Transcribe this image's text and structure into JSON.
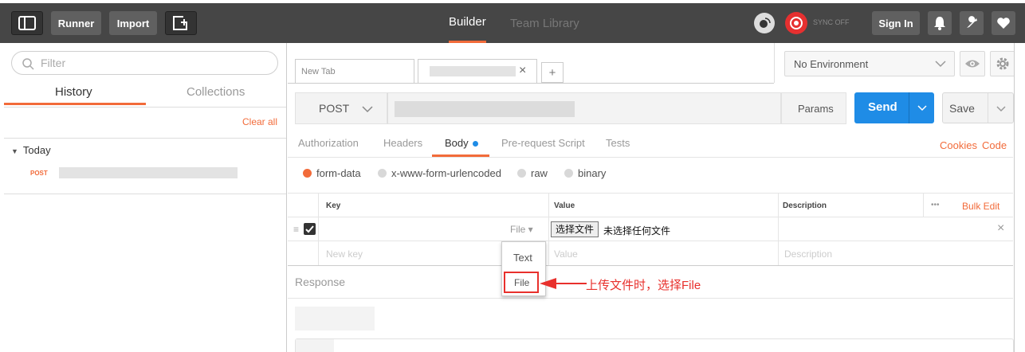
{
  "topbar": {
    "runner": "Runner",
    "import": "Import",
    "builder": "Builder",
    "team_library": "Team Library",
    "sync": "SYNC OFF",
    "sign_in": "Sign In"
  },
  "sidebar": {
    "filter_placeholder": "Filter",
    "tabs": [
      "History",
      "Collections"
    ],
    "clear_all": "Clear all",
    "group": "Today",
    "item_method": "POST"
  },
  "tabs": {
    "new_tab": "New Tab",
    "add": "+",
    "close": "×"
  },
  "environment": {
    "selected": "No Environment"
  },
  "request": {
    "method": "POST",
    "params": "Params",
    "send": "Send",
    "save": "Save"
  },
  "subtabs": [
    "Authorization",
    "Headers",
    "Body",
    "Pre-request Script",
    "Tests"
  ],
  "links": {
    "cookies": "Cookies",
    "code": "Code"
  },
  "body_types": [
    "form-data",
    "x-www-form-urlencoded",
    "raw",
    "binary"
  ],
  "table": {
    "headers": {
      "key": "Key",
      "value": "Value",
      "description": "Description",
      "more": "•••",
      "bulk_edit": "Bulk Edit"
    },
    "row": {
      "type": "File ▾",
      "choose_button": "选择文件",
      "no_file": "未选择任何文件"
    },
    "new_row": {
      "key": "New key",
      "value": "Value",
      "description": "Description"
    }
  },
  "dropdown": [
    "Text",
    "File"
  ],
  "annotation": "上传文件时，选择File",
  "response": {
    "label": "Response"
  },
  "colors": {
    "accent": "#f26b3a",
    "send_blue": "#1f8ce6",
    "topbar": "#464646",
    "annotation_red": "#e8302c"
  }
}
